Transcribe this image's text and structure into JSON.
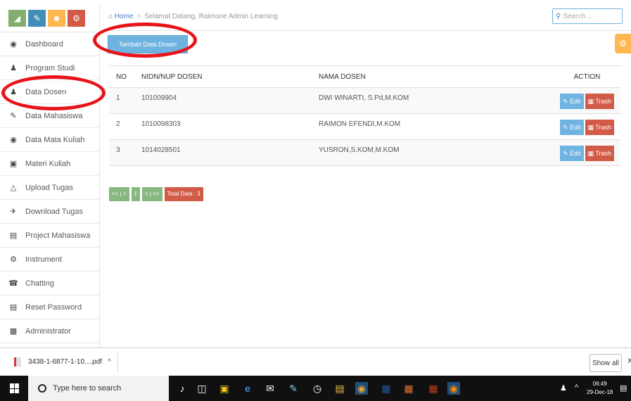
{
  "sidebar": {
    "shortcuts": [
      {
        "icon": "chart-icon",
        "color": "#82af6f"
      },
      {
        "icon": "pencil-icon",
        "color": "#438eb9"
      },
      {
        "icon": "users-icon",
        "color": "#ffb752"
      },
      {
        "icon": "cogs-icon",
        "color": "#d15b47"
      }
    ],
    "items": [
      {
        "label": "Dashboard",
        "icon": "tachometer-icon"
      },
      {
        "label": "Program Studi",
        "icon": "group-icon"
      },
      {
        "label": "Data Dosen",
        "icon": "user-icon"
      },
      {
        "label": "Data Mahasiswa",
        "icon": "pencil-square-icon"
      },
      {
        "label": "Data Mata Kuliah",
        "icon": "eye-icon"
      },
      {
        "label": "Materi Kuliah",
        "icon": "inbox-icon"
      },
      {
        "label": "Upload Tugas",
        "icon": "flask-icon"
      },
      {
        "label": "Download Tugas",
        "icon": "plane-icon"
      },
      {
        "label": "Project Mahasiswa",
        "icon": "briefcase-icon"
      },
      {
        "label": "Instrument",
        "icon": "cogs-icon"
      },
      {
        "label": "Chatting",
        "icon": "microphone-icon"
      },
      {
        "label": "Reset Password",
        "icon": "file-icon"
      },
      {
        "label": "Administrator",
        "icon": "book-icon"
      }
    ]
  },
  "breadcrumb": {
    "home": "Home",
    "current": "Selamat Datang, Raimone Admin Learning"
  },
  "search": {
    "placeholder": "Search ..."
  },
  "main": {
    "add_button": "Tambah Data Dosen",
    "table": {
      "headers": [
        "NO",
        "NIDN/NUP DOSEN",
        "NAMA DOSEN",
        "ACTION"
      ],
      "rows": [
        {
          "no": "1",
          "nidn": "101009904",
          "nama": "DWI WINARTI, S.Pd,M.KOM"
        },
        {
          "no": "2",
          "nidn": "1010098303",
          "nama": "RAIMON EFENDI,M.KOM"
        },
        {
          "no": "3",
          "nidn": "1014028501",
          "nama": "YUSRON,S.KOM,M.KOM"
        }
      ],
      "edit_label": "Edit",
      "trash_label": "Trash"
    },
    "pager": {
      "first": "<< | <",
      "page": "1",
      "last": "> | >>",
      "total": "Total Data : 3"
    }
  },
  "downloads": {
    "file": "3438-1-6877-1-10....pdf",
    "chevron": "^",
    "show_all": "Show all",
    "close": "X"
  },
  "taskbar": {
    "search_text": "Type here to search",
    "time": "06:49",
    "date": "29-Dec-18"
  }
}
